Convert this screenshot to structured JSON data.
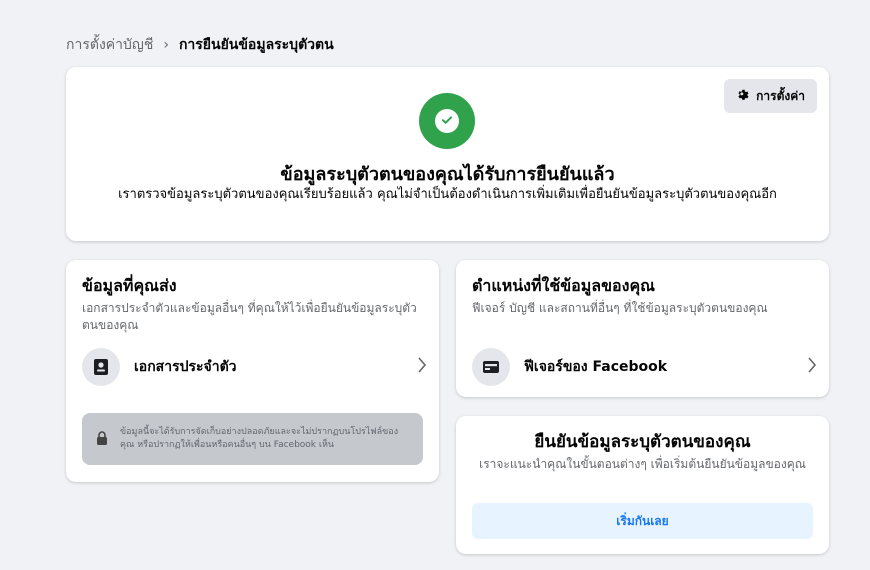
{
  "breadcrumb": {
    "parent": "การตั้งค่าบัญชี",
    "separator": "›",
    "current": "การยืนยันข้อมูลระบุตัวตน"
  },
  "hero": {
    "settings_label": "การตั้งค่า",
    "title": "ข้อมูลระบุตัวตนของคุณได้รับการยืนยันแล้ว",
    "description": "เราตรวจข้อมูลระบุตัวตนของคุณเรียบร้อยแล้ว คุณไม่จำเป็นต้องดำเนินการเพิ่มเติมเพื่อยืนยันข้อมูลระบุตัวตนของคุณอีก"
  },
  "info_sent": {
    "title": "ข้อมูลที่คุณส่ง",
    "description": "เอกสารประจำตัวและข้อมูลอื่นๆ ที่คุณให้ไว้เพื่อยืนยันข้อมูลระบุตัวตนของคุณ",
    "row_label": "เอกสารประจำตัว",
    "privacy_note": "ข้อมูลนี้จะได้รับการจัดเก็บอย่างปลอดภัยและจะไม่ปรากฏบนโปรไฟล์ของคุณ หรือปรากฏให้เพื่อนหรือคนอื่นๆ บน Facebook เห็น"
  },
  "usage": {
    "title": "ตำแหน่งที่ใช้ข้อมูลของคุณ",
    "description": "ฟีเจอร์ บัญชี และสถานที่อื่นๆ ที่ใช้ข้อมูลระบุตัวตนของคุณ",
    "row_label": "ฟีเจอร์ของ Facebook"
  },
  "verify": {
    "title": "ยืนยันข้อมูลระบุตัวตนของคุณ",
    "description": "เราจะแนะนำคุณในขั้นตอนต่างๆ เพื่อเริ่มต้นยืนยันข้อมูลของคุณ",
    "button_label": "เริ่มกันเลย"
  },
  "colors": {
    "accent": "#1877f2",
    "success": "#31a24c",
    "background": "#f0f2f5"
  },
  "icons": [
    "gear-icon",
    "checkmark-icon",
    "id-document-icon",
    "chevron-right-icon",
    "lock-icon",
    "card-icon"
  ]
}
